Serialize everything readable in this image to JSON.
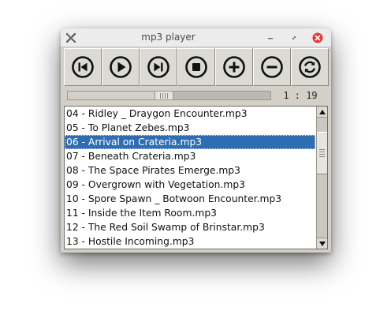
{
  "window": {
    "title": "mp3 player",
    "app_icon": "x-app-icon",
    "controls": [
      "minimize-icon",
      "maximize-icon",
      "close-icon"
    ],
    "close_color": "#e03c3c"
  },
  "toolbar": {
    "buttons": [
      {
        "name": "previous-button",
        "icon": "skip-previous-icon"
      },
      {
        "name": "play-button",
        "icon": "play-icon"
      },
      {
        "name": "next-button",
        "icon": "skip-next-icon"
      },
      {
        "name": "stop-button",
        "icon": "stop-icon"
      },
      {
        "name": "add-button",
        "icon": "plus-icon"
      },
      {
        "name": "remove-button",
        "icon": "minus-icon"
      },
      {
        "name": "repeat-button",
        "icon": "repeat-icon"
      }
    ]
  },
  "playback": {
    "position_fraction": 0.47,
    "elapsed": "1 : 19"
  },
  "playlist": {
    "items": [
      "04 - Ridley _ Draygon Encounter.mp3",
      "05 - To Planet Zebes.mp3",
      "06 - Arrival on Crateria.mp3",
      "07 - Beneath Crateria.mp3",
      "08 - The Space Pirates Emerge.mp3",
      "09 - Overgrown with Vegetation.mp3",
      "10 - Spore Spawn _ Botwoon Encounter.mp3",
      "11 - Inside the Item Room.mp3",
      "12 - The Red Soil Swamp of Brinstar.mp3",
      "13 - Hostile Incoming.mp3"
    ],
    "selected_index": 2,
    "selection_color": "#2f6db3"
  }
}
